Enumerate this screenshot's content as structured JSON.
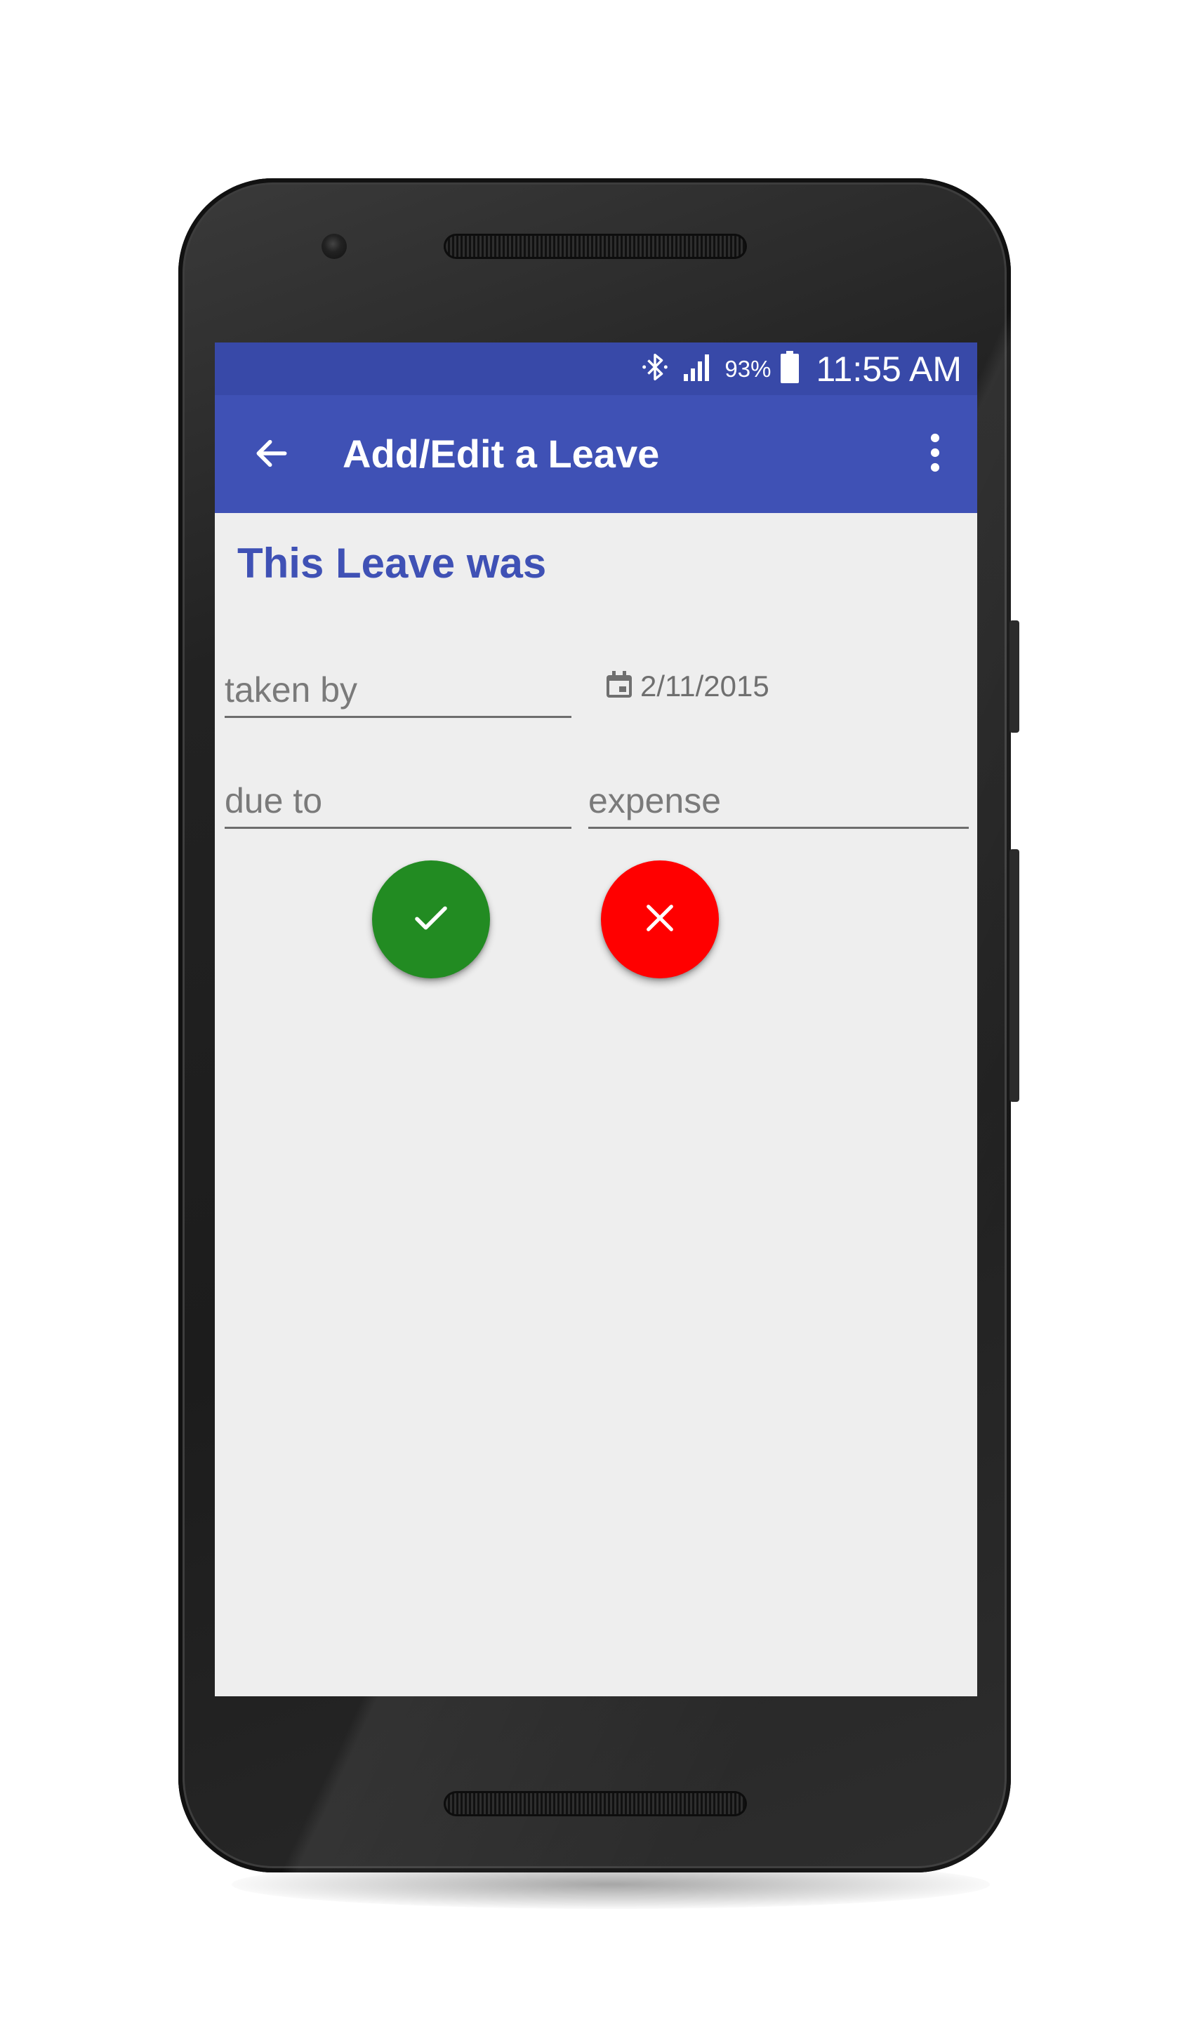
{
  "status_bar": {
    "battery_percent": "93%",
    "time": "11:55 AM",
    "icons": [
      "bluetooth-icon",
      "signal-icon",
      "battery-icon"
    ]
  },
  "app_bar": {
    "title": "Add/Edit a Leave",
    "back_icon": "arrow-back-icon",
    "overflow_icon": "more-vert-icon"
  },
  "form": {
    "heading": "This Leave was",
    "taken_by_placeholder": "taken by",
    "date_value": "2/11/2015",
    "date_icon": "calendar-icon",
    "due_to_placeholder": "due to",
    "expense_placeholder": "expense"
  },
  "actions": {
    "confirm_icon": "check-icon",
    "cancel_icon": "close-icon"
  },
  "colors": {
    "primary": "#3f51b5",
    "primary_dark": "#3849a8",
    "confirm": "#228b22",
    "cancel": "#ff0000",
    "background": "#eeeeee"
  }
}
